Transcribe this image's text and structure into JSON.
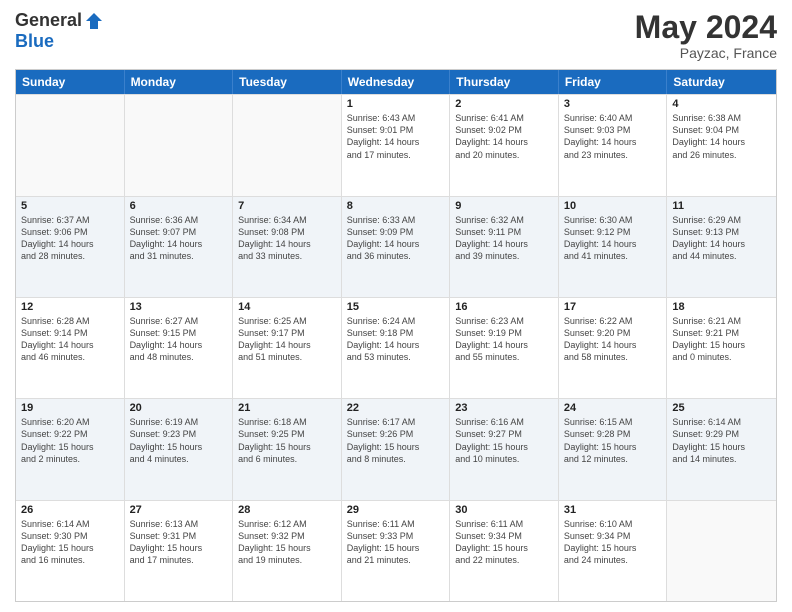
{
  "header": {
    "logo_general": "General",
    "logo_blue": "Blue",
    "month": "May 2024",
    "location": "Payzac, France"
  },
  "days": [
    "Sunday",
    "Monday",
    "Tuesday",
    "Wednesday",
    "Thursday",
    "Friday",
    "Saturday"
  ],
  "rows": [
    [
      {
        "day": "",
        "lines": []
      },
      {
        "day": "",
        "lines": []
      },
      {
        "day": "",
        "lines": []
      },
      {
        "day": "1",
        "lines": [
          "Sunrise: 6:43 AM",
          "Sunset: 9:01 PM",
          "Daylight: 14 hours",
          "and 17 minutes."
        ]
      },
      {
        "day": "2",
        "lines": [
          "Sunrise: 6:41 AM",
          "Sunset: 9:02 PM",
          "Daylight: 14 hours",
          "and 20 minutes."
        ]
      },
      {
        "day": "3",
        "lines": [
          "Sunrise: 6:40 AM",
          "Sunset: 9:03 PM",
          "Daylight: 14 hours",
          "and 23 minutes."
        ]
      },
      {
        "day": "4",
        "lines": [
          "Sunrise: 6:38 AM",
          "Sunset: 9:04 PM",
          "Daylight: 14 hours",
          "and 26 minutes."
        ]
      }
    ],
    [
      {
        "day": "5",
        "lines": [
          "Sunrise: 6:37 AM",
          "Sunset: 9:06 PM",
          "Daylight: 14 hours",
          "and 28 minutes."
        ]
      },
      {
        "day": "6",
        "lines": [
          "Sunrise: 6:36 AM",
          "Sunset: 9:07 PM",
          "Daylight: 14 hours",
          "and 31 minutes."
        ]
      },
      {
        "day": "7",
        "lines": [
          "Sunrise: 6:34 AM",
          "Sunset: 9:08 PM",
          "Daylight: 14 hours",
          "and 33 minutes."
        ]
      },
      {
        "day": "8",
        "lines": [
          "Sunrise: 6:33 AM",
          "Sunset: 9:09 PM",
          "Daylight: 14 hours",
          "and 36 minutes."
        ]
      },
      {
        "day": "9",
        "lines": [
          "Sunrise: 6:32 AM",
          "Sunset: 9:11 PM",
          "Daylight: 14 hours",
          "and 39 minutes."
        ]
      },
      {
        "day": "10",
        "lines": [
          "Sunrise: 6:30 AM",
          "Sunset: 9:12 PM",
          "Daylight: 14 hours",
          "and 41 minutes."
        ]
      },
      {
        "day": "11",
        "lines": [
          "Sunrise: 6:29 AM",
          "Sunset: 9:13 PM",
          "Daylight: 14 hours",
          "and 44 minutes."
        ]
      }
    ],
    [
      {
        "day": "12",
        "lines": [
          "Sunrise: 6:28 AM",
          "Sunset: 9:14 PM",
          "Daylight: 14 hours",
          "and 46 minutes."
        ]
      },
      {
        "day": "13",
        "lines": [
          "Sunrise: 6:27 AM",
          "Sunset: 9:15 PM",
          "Daylight: 14 hours",
          "and 48 minutes."
        ]
      },
      {
        "day": "14",
        "lines": [
          "Sunrise: 6:25 AM",
          "Sunset: 9:17 PM",
          "Daylight: 14 hours",
          "and 51 minutes."
        ]
      },
      {
        "day": "15",
        "lines": [
          "Sunrise: 6:24 AM",
          "Sunset: 9:18 PM",
          "Daylight: 14 hours",
          "and 53 minutes."
        ]
      },
      {
        "day": "16",
        "lines": [
          "Sunrise: 6:23 AM",
          "Sunset: 9:19 PM",
          "Daylight: 14 hours",
          "and 55 minutes."
        ]
      },
      {
        "day": "17",
        "lines": [
          "Sunrise: 6:22 AM",
          "Sunset: 9:20 PM",
          "Daylight: 14 hours",
          "and 58 minutes."
        ]
      },
      {
        "day": "18",
        "lines": [
          "Sunrise: 6:21 AM",
          "Sunset: 9:21 PM",
          "Daylight: 15 hours",
          "and 0 minutes."
        ]
      }
    ],
    [
      {
        "day": "19",
        "lines": [
          "Sunrise: 6:20 AM",
          "Sunset: 9:22 PM",
          "Daylight: 15 hours",
          "and 2 minutes."
        ]
      },
      {
        "day": "20",
        "lines": [
          "Sunrise: 6:19 AM",
          "Sunset: 9:23 PM",
          "Daylight: 15 hours",
          "and 4 minutes."
        ]
      },
      {
        "day": "21",
        "lines": [
          "Sunrise: 6:18 AM",
          "Sunset: 9:25 PM",
          "Daylight: 15 hours",
          "and 6 minutes."
        ]
      },
      {
        "day": "22",
        "lines": [
          "Sunrise: 6:17 AM",
          "Sunset: 9:26 PM",
          "Daylight: 15 hours",
          "and 8 minutes."
        ]
      },
      {
        "day": "23",
        "lines": [
          "Sunrise: 6:16 AM",
          "Sunset: 9:27 PM",
          "Daylight: 15 hours",
          "and 10 minutes."
        ]
      },
      {
        "day": "24",
        "lines": [
          "Sunrise: 6:15 AM",
          "Sunset: 9:28 PM",
          "Daylight: 15 hours",
          "and 12 minutes."
        ]
      },
      {
        "day": "25",
        "lines": [
          "Sunrise: 6:14 AM",
          "Sunset: 9:29 PM",
          "Daylight: 15 hours",
          "and 14 minutes."
        ]
      }
    ],
    [
      {
        "day": "26",
        "lines": [
          "Sunrise: 6:14 AM",
          "Sunset: 9:30 PM",
          "Daylight: 15 hours",
          "and 16 minutes."
        ]
      },
      {
        "day": "27",
        "lines": [
          "Sunrise: 6:13 AM",
          "Sunset: 9:31 PM",
          "Daylight: 15 hours",
          "and 17 minutes."
        ]
      },
      {
        "day": "28",
        "lines": [
          "Sunrise: 6:12 AM",
          "Sunset: 9:32 PM",
          "Daylight: 15 hours",
          "and 19 minutes."
        ]
      },
      {
        "day": "29",
        "lines": [
          "Sunrise: 6:11 AM",
          "Sunset: 9:33 PM",
          "Daylight: 15 hours",
          "and 21 minutes."
        ]
      },
      {
        "day": "30",
        "lines": [
          "Sunrise: 6:11 AM",
          "Sunset: 9:34 PM",
          "Daylight: 15 hours",
          "and 22 minutes."
        ]
      },
      {
        "day": "31",
        "lines": [
          "Sunrise: 6:10 AM",
          "Sunset: 9:34 PM",
          "Daylight: 15 hours",
          "and 24 minutes."
        ]
      },
      {
        "day": "",
        "lines": []
      }
    ]
  ]
}
